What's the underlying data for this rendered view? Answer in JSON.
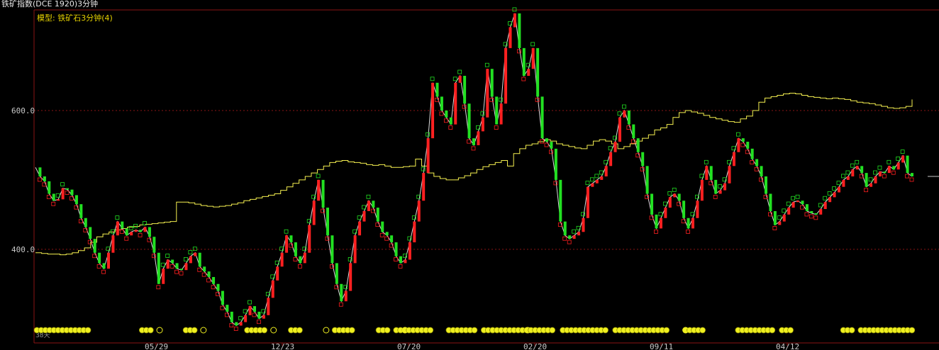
{
  "header": {
    "title": "铁矿指数(DCE 1920)3分钟",
    "model_label": "模型: 铁矿石3分钟(4)",
    "corner_label": "38天"
  },
  "colors": {
    "background": "#000000",
    "axis": "#8a1414",
    "grid": "#8a1414",
    "bull_candle": "#ff2020",
    "bear_candle": "#22e022",
    "price_line": "#dcdcdc",
    "equity_line": "#f5f050",
    "signal_marker": "#f0f020"
  },
  "chart_data": {
    "type": "line",
    "title": "铁矿指数(DCE 1920)3分钟",
    "ylim": [
      265,
      745
    ],
    "y_gridlines": [
      400,
      600
    ],
    "y_tick_labels": [
      "400.0",
      "600.0"
    ],
    "x_tick_labels": [
      "05/29",
      "12/23",
      "07/20",
      "02/20",
      "09/11",
      "04/12"
    ],
    "grid": true,
    "series": [
      {
        "kind": "price",
        "values": [
          518,
          505,
          498,
          480,
          470,
          472,
          488,
          486,
          478,
          465,
          445,
          432,
          415,
          395,
          380,
          372,
          395,
          420,
          440,
          430,
          420,
          425,
          428,
          425,
          432,
          418,
          395,
          350,
          372,
          385,
          380,
          372,
          370,
          380,
          390,
          395,
          375,
          368,
          360,
          350,
          340,
          320,
          310,
          295,
          290,
          295,
          305,
          318,
          310,
          300,
          305,
          330,
          355,
          375,
          395,
          420,
          410,
          390,
          380,
          395,
          435,
          470,
          500,
          460,
          420,
          380,
          350,
          325,
          340,
          380,
          420,
          440,
          455,
          470,
          460,
          440,
          425,
          420,
          410,
          390,
          380,
          385,
          410,
          440,
          470,
          510,
          560,
          640,
          620,
          600,
          590,
          580,
          640,
          650,
          610,
          560,
          550,
          570,
          590,
          660,
          620,
          580,
          610,
          690,
          720,
          740,
          690,
          650,
          660,
          690,
          620,
          560,
          555,
          545,
          500,
          440,
          420,
          415,
          420,
          425,
          445,
          490,
          495,
          500,
          505,
          520,
          540,
          555,
          590,
          600,
          580,
          560,
          540,
          520,
          480,
          450,
          430,
          445,
          460,
          475,
          480,
          470,
          445,
          430,
          445,
          470,
          500,
          520,
          500,
          480,
          485,
          495,
          520,
          540,
          560,
          555,
          545,
          530,
          520,
          505,
          480,
          455,
          435,
          440,
          450,
          460,
          468,
          470,
          465,
          455,
          452,
          450,
          458,
          468,
          475,
          482,
          490,
          500,
          505,
          515,
          520,
          510,
          490,
          495,
          505,
          512,
          510,
          520,
          515,
          525,
          535,
          510,
          505
        ]
      },
      {
        "kind": "equity",
        "values": [
          395,
          394,
          393,
          393,
          392,
          393,
          395,
          398,
          402,
          410,
          418,
          422,
          425,
          428,
          430,
          432,
          433,
          435,
          436,
          437,
          438,
          439,
          440,
          468,
          468,
          467,
          465,
          463,
          462,
          461,
          462,
          463,
          465,
          467,
          470,
          472,
          474,
          476,
          478,
          480,
          485,
          490,
          495,
          500,
          505,
          510,
          515,
          520,
          525,
          527,
          528,
          526,
          525,
          524,
          522,
          521,
          522,
          520,
          518,
          518,
          519,
          520,
          530,
          520,
          510,
          505,
          502,
          500,
          500,
          503,
          506,
          510,
          515,
          519,
          522,
          525,
          528,
          520,
          538,
          545,
          550,
          552,
          555,
          558,
          556,
          552,
          550,
          548,
          546,
          545,
          550,
          556,
          558,
          556,
          552,
          545,
          548,
          552,
          556,
          560,
          565,
          572,
          575,
          580,
          590,
          597,
          600,
          598,
          596,
          593,
          590,
          588,
          586,
          584,
          583,
          588,
          592,
          600,
          612,
          618,
          620,
          622,
          624,
          625,
          624,
          622,
          620,
          619,
          618,
          617,
          618,
          617,
          616,
          614,
          612,
          611,
          610,
          608,
          606,
          604,
          603,
          604,
          606,
          616
        ]
      }
    ],
    "signal_markers": [
      [
        0.0,
        0.06
      ],
      [
        0.12,
        0.13
      ],
      [
        0.17,
        0.18
      ],
      [
        0.24,
        0.26
      ],
      [
        0.29,
        0.3
      ],
      [
        0.34,
        0.36
      ],
      [
        0.39,
        0.4
      ],
      [
        0.41,
        0.45
      ],
      [
        0.47,
        0.5
      ],
      [
        0.51,
        0.52
      ],
      [
        0.52,
        0.59
      ],
      [
        0.6,
        0.65
      ],
      [
        0.66,
        0.72
      ],
      [
        0.74,
        0.76
      ],
      [
        0.8,
        0.84
      ],
      [
        0.85,
        0.86
      ],
      [
        0.92,
        0.93
      ],
      [
        0.94,
        0.999
      ]
    ]
  }
}
